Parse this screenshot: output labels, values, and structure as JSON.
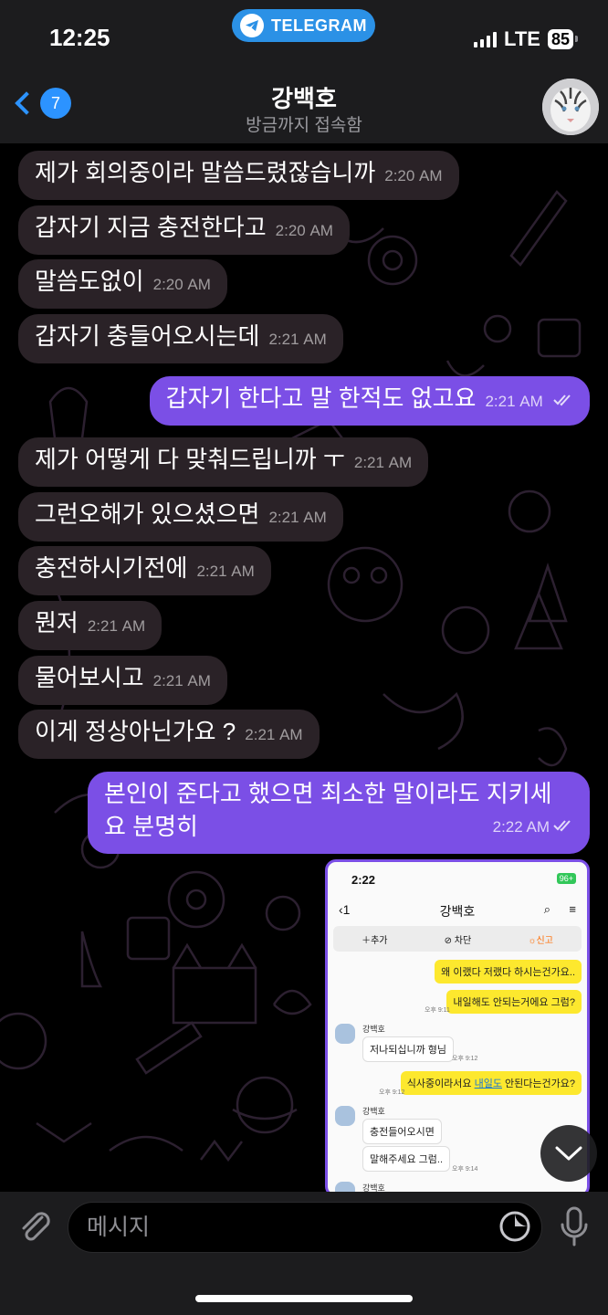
{
  "status_bar": {
    "time": "12:25",
    "app_pill": "TELEGRAM",
    "network": "LTE",
    "battery": "85"
  },
  "header": {
    "back_badge": "7",
    "chat_name": "강백호",
    "chat_status": "방금까지 접속함",
    "avatar_icon": "white-tiger-avatar"
  },
  "messages": [
    {
      "dir": "in",
      "text": "제가 회의중이라 말씀드렸잖습니까",
      "time": "2:20 AM"
    },
    {
      "dir": "in",
      "text": "갑자기 지금 충전한다고",
      "time": "2:20 AM"
    },
    {
      "dir": "in",
      "text": "말씀도없이",
      "time": "2:20 AM"
    },
    {
      "dir": "in",
      "text": "갑자기 충들어오시는데",
      "time": "2:21 AM"
    },
    {
      "dir": "out",
      "text": "갑자기 한다고 말 한적도 없고요",
      "time": "2:21 AM"
    },
    {
      "dir": "in",
      "text": "제가 어떻게 다 맞춰드립니까 ㅜ",
      "time": "2:21 AM"
    },
    {
      "dir": "in",
      "text": "그런오해가 있으셨으면",
      "time": "2:21 AM"
    },
    {
      "dir": "in",
      "text": "충전하시기전에",
      "time": "2:21 AM"
    },
    {
      "dir": "in",
      "text": "뭔저",
      "time": "2:21 AM"
    },
    {
      "dir": "in",
      "text": "물어보시고",
      "time": "2:21 AM"
    },
    {
      "dir": "in",
      "text": "이게 정상아닌가요 ?",
      "time": "2:21 AM"
    },
    {
      "dir": "out",
      "text_line1": "본인이 준다고 했으면 최소한 말이라도 지키세",
      "text_line2": "요 분명히",
      "time": "2:22 AM"
    }
  ],
  "embedded_screenshot": {
    "time": "2:22",
    "battery": "96+",
    "back_count": "1",
    "name": "강백호",
    "tool_add": "추가",
    "tool_block": "차단",
    "tool_report": "신고",
    "bubbles": {
      "y1": "왜 이랬다 저랬다 하시는건가요..",
      "y2": "내일해도 안되는거에요 그럼?",
      "y1_time": "오후 9:11",
      "sender1": "강백호",
      "g1": "저나되십니까 형님",
      "g1_time": "오후 9:12",
      "y3_pre": "식사중이라서요 ",
      "y3_link": "내일도",
      "y3_post": " 안된다는건가요?",
      "y3_time": "오후 9:12",
      "sender2": "강백호",
      "g2": "충전들어오시면",
      "g3": "말해주세요 그럼..",
      "g3_time": "오후 9:14",
      "sender3": "강백호"
    }
  },
  "input": {
    "placeholder": "메시지"
  },
  "colors": {
    "accent": "#2c93ff",
    "outgoing": "#7b4fe6",
    "incoming": "#2a2227"
  }
}
